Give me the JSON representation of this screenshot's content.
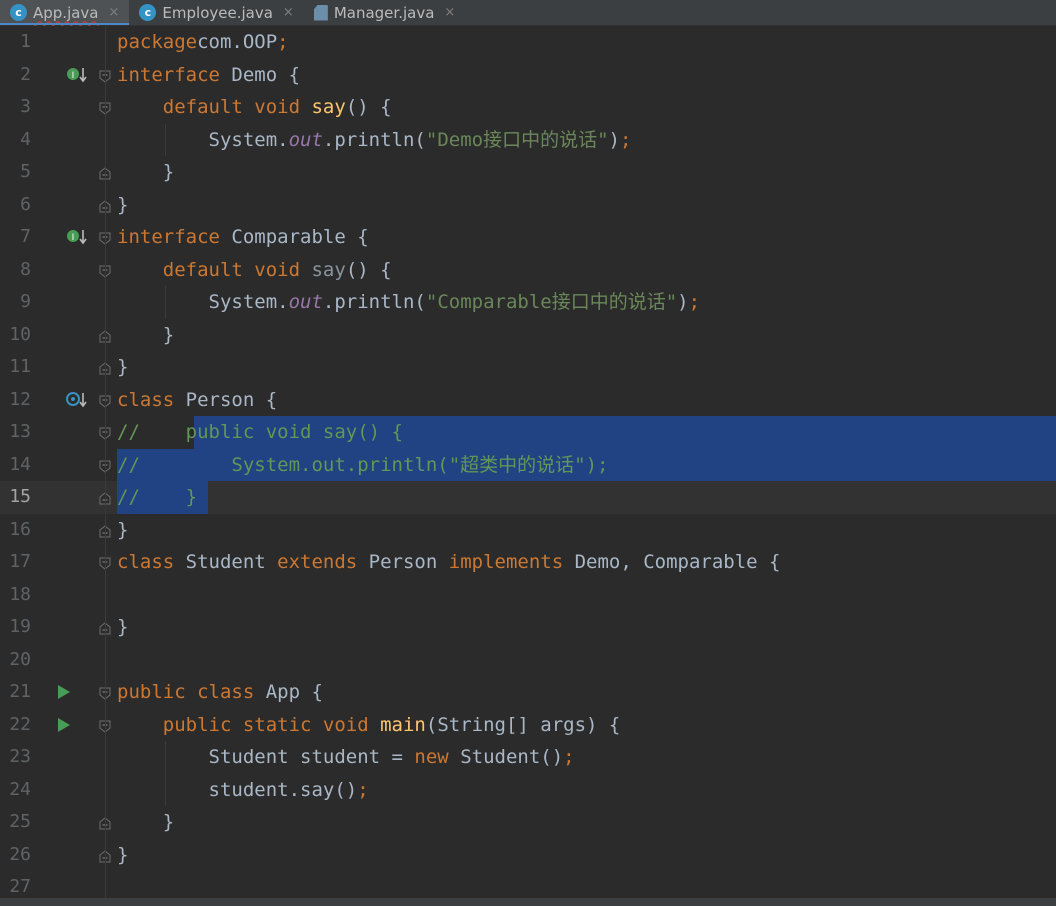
{
  "tabs": [
    {
      "label": "App.java",
      "icon": "java-class-icon",
      "active": true,
      "error": true
    },
    {
      "label": "Employee.java",
      "icon": "java-class-icon",
      "active": false,
      "error": false
    },
    {
      "label": "Manager.java",
      "icon": "java-file-icon",
      "active": false,
      "error": false
    }
  ],
  "tab_close_glyph": "×",
  "current_line": 15,
  "lines": [
    {
      "n": "1",
      "tokens": [
        [
          "kw",
          "package"
        ],
        [
          "",
          "com.OOP"
        ],
        [
          "kw",
          ";"
        ]
      ]
    },
    {
      "n": "2",
      "icon": "implemented-interface-icon",
      "tokens": [
        [
          "kw",
          "interface "
        ],
        [
          "",
          "Demo {"
        ]
      ]
    },
    {
      "n": "3",
      "tokens": [
        [
          "",
          "    "
        ],
        [
          "kw",
          "default void "
        ],
        [
          "fn",
          "say"
        ],
        [
          "",
          "() {"
        ]
      ]
    },
    {
      "n": "4",
      "tokens": [
        [
          "",
          "        System."
        ],
        [
          "st",
          "out"
        ],
        [
          "",
          ".println("
        ],
        [
          "str",
          "\"Demo接口中的说话\""
        ],
        [
          "",
          ")"
        ],
        [
          "kw",
          ";"
        ]
      ]
    },
    {
      "n": "5",
      "tokens": [
        [
          "",
          "    }"
        ]
      ]
    },
    {
      "n": "6",
      "tokens": [
        [
          "",
          "}"
        ]
      ]
    },
    {
      "n": "7",
      "icon": "implemented-interface-icon",
      "tokens": [
        [
          "kw",
          "interface "
        ],
        [
          "",
          "Comparable {"
        ]
      ]
    },
    {
      "n": "8",
      "tokens": [
        [
          "",
          "    "
        ],
        [
          "kw",
          "default void "
        ],
        [
          "dim",
          "say"
        ],
        [
          "",
          "() {"
        ]
      ]
    },
    {
      "n": "9",
      "tokens": [
        [
          "",
          "        System."
        ],
        [
          "st",
          "out"
        ],
        [
          "",
          ".println("
        ],
        [
          "str",
          "\"Comparable接口中的说话\""
        ],
        [
          "",
          ")"
        ],
        [
          "kw",
          ";"
        ]
      ]
    },
    {
      "n": "10",
      "tokens": [
        [
          "",
          "    }"
        ]
      ]
    },
    {
      "n": "11",
      "tokens": [
        [
          "",
          "}"
        ]
      ]
    },
    {
      "n": "12",
      "icon": "subclassed-icon",
      "tokens": [
        [
          "kw",
          "class "
        ],
        [
          "",
          "Person {"
        ]
      ]
    },
    {
      "n": "13",
      "sel": [
        0,
        11
      ],
      "tokens": [
        [
          "cm",
          "//    public void say() {"
        ]
      ]
    },
    {
      "n": "14",
      "sel": [
        0,
        21
      ],
      "tokens": [
        [
          "cm",
          "//        System.out.println(\"超类中的说话\");"
        ]
      ]
    },
    {
      "n": "15",
      "sel": [
        0,
        7
      ],
      "tokens": [
        [
          "cm",
          "//    }"
        ]
      ]
    },
    {
      "n": "16",
      "tokens": [
        [
          "",
          "}"
        ]
      ]
    },
    {
      "n": "17",
      "tokens": [
        [
          "kw",
          "class "
        ],
        [
          "",
          "Student "
        ],
        [
          "kw",
          "extends "
        ],
        [
          "",
          "Person "
        ],
        [
          "kw",
          "implements "
        ],
        [
          "",
          "Demo, Comparable {"
        ]
      ]
    },
    {
      "n": "18",
      "tokens": []
    },
    {
      "n": "19",
      "tokens": [
        [
          "",
          "}"
        ]
      ]
    },
    {
      "n": "20",
      "tokens": []
    },
    {
      "n": "21",
      "icon": "run-icon",
      "tokens": [
        [
          "kw",
          "public class "
        ],
        [
          "",
          "App {"
        ]
      ]
    },
    {
      "n": "22",
      "icon": "run-icon",
      "tokens": [
        [
          "",
          "    "
        ],
        [
          "kw",
          "public static void "
        ],
        [
          "fn",
          "main"
        ],
        [
          "",
          "(String[] args) {"
        ]
      ]
    },
    {
      "n": "23",
      "tokens": [
        [
          "",
          "        Student student = "
        ],
        [
          "kw",
          "new "
        ],
        [
          "",
          "Student()"
        ],
        [
          "kw",
          ";"
        ]
      ]
    },
    {
      "n": "24",
      "tokens": [
        [
          "",
          "        student.say()"
        ],
        [
          "kw",
          ";"
        ]
      ]
    },
    {
      "n": "25",
      "tokens": [
        [
          "",
          "    }"
        ]
      ]
    },
    {
      "n": "26",
      "tokens": [
        [
          "",
          "}"
        ]
      ]
    },
    {
      "n": "27",
      "tokens": []
    }
  ],
  "colors": {
    "keyword": "#cc7832",
    "method": "#ffc66d",
    "string": "#6a8759",
    "static_field": "#9876aa",
    "comment": "#629755",
    "selection": "#214283",
    "text": "#a9b7c6"
  }
}
